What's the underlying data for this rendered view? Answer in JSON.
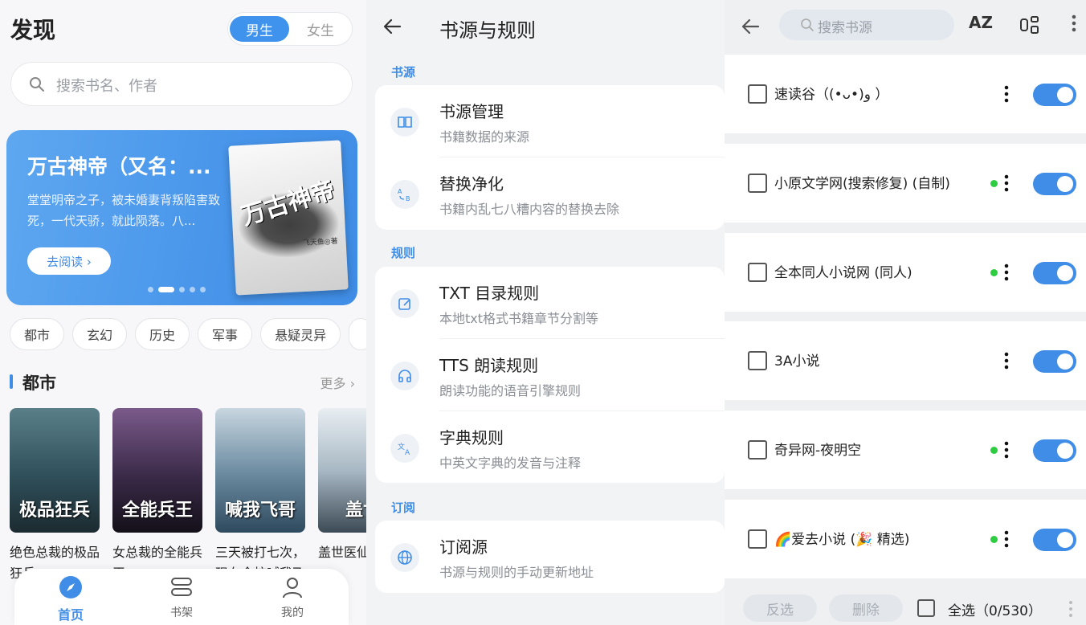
{
  "discover": {
    "title": "发现",
    "gender": {
      "male": "男生",
      "female": "女生"
    },
    "search_placeholder": "搜索书名、作者",
    "banner": {
      "title": "万古神帝（又名：...",
      "desc": "堂堂明帝之子，被未婚妻背叛陷害致死，一代天骄，就此陨落。八...",
      "button": "去阅读 ›",
      "cover_title": "万古神帝",
      "cover_author": "飞天鱼◎著"
    },
    "tags": [
      "都市",
      "玄幻",
      "历史",
      "军事",
      "悬疑灵异"
    ],
    "section": {
      "title": "都市",
      "more": "更多 ›"
    },
    "books": [
      {
        "name": "绝色总裁的极品狂兵",
        "cover_text": "极品狂兵"
      },
      {
        "name": "女总裁的全能兵王",
        "cover_text": "全能兵王"
      },
      {
        "name": "三天被打七次，现在全校喊我飞哥",
        "cover_text": "喊我飞哥"
      },
      {
        "name": "盖世医仙",
        "cover_text": "盖世"
      }
    ],
    "nav": {
      "home": "首页",
      "shelf": "书架",
      "mine": "我的"
    }
  },
  "rules": {
    "title": "书源与规则",
    "group_source": "书源",
    "group_rules": "规则",
    "group_subscribe": "订阅",
    "items": [
      {
        "title": "书源管理",
        "sub": "书籍数据的来源",
        "icon": "book-icon"
      },
      {
        "title": "替换净化",
        "sub": "书籍内乱七八糟内容的替换去除",
        "icon": "replace-icon"
      },
      {
        "title": "TXT 目录规则",
        "sub": "本地txt格式书籍章节分割等",
        "icon": "edit-icon"
      },
      {
        "title": "TTS 朗读规则",
        "sub": "朗读功能的语音引擎规则",
        "icon": "headphones-icon"
      },
      {
        "title": "字典规则",
        "sub": "中英文字典的发音与注释",
        "icon": "translate-icon"
      },
      {
        "title": "订阅源",
        "sub": "书源与规则的手动更新地址",
        "icon": "globe-icon"
      }
    ]
  },
  "sources": {
    "search_placeholder": "搜索书源",
    "az": "AZ",
    "items": [
      {
        "name": "速读谷（(•ᴗ•)و ）",
        "dot": false
      },
      {
        "name": "小原文学网(搜索修复) (自制)",
        "dot": true
      },
      {
        "name": "全本同人小说网 (同人)",
        "dot": true
      },
      {
        "name": "3A小说",
        "dot": false
      },
      {
        "name": "奇异网-夜明空",
        "dot": true
      },
      {
        "name": "🌈爱去小说 (🎉 精选)",
        "dot": true
      }
    ],
    "footer": {
      "invert": "反选",
      "delete": "删除",
      "select_all": "全选（0/530）"
    }
  },
  "colors": {
    "accent": "#3f8de6",
    "online_dot": "#2ecc40"
  }
}
